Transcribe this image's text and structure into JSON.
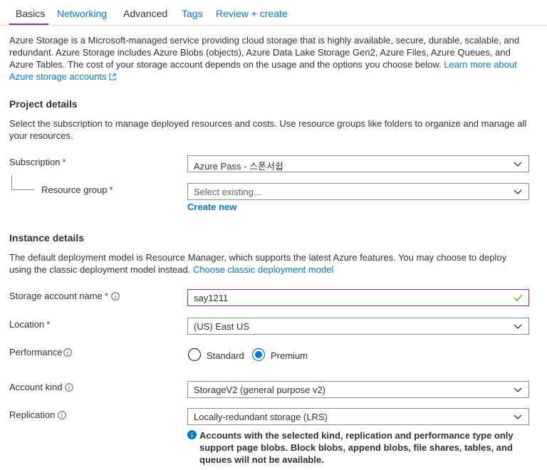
{
  "tabs": [
    {
      "label": "Basics",
      "active": true
    },
    {
      "label": "Networking",
      "active": false
    },
    {
      "label": "Advanced",
      "active": false
    },
    {
      "label": "Tags",
      "active": false
    },
    {
      "label": "Review + create",
      "active": false
    }
  ],
  "intro": {
    "text": "Azure Storage is a Microsoft-managed service providing cloud storage that is highly available, secure, durable, scalable, and redundant. Azure Storage includes Azure Blobs (objects), Azure Data Lake Storage Gen2, Azure Files, Azure Queues, and Azure Tables. The cost of your storage account depends on the usage and the options you choose below.",
    "link": "Learn more about Azure storage accounts"
  },
  "project": {
    "title": "Project details",
    "description": "Select the subscription to manage deployed resources and costs. Use resource groups like folders to organize and manage all your resources.",
    "subscription_label": "Subscription",
    "subscription_value": "Azure Pass - 스폰서쉽",
    "resource_group_label": "Resource group",
    "resource_group_placeholder": "Select existing...",
    "create_new": "Create new"
  },
  "instance": {
    "title": "Instance details",
    "description": "The default deployment model is Resource Manager, which supports the latest Azure features. You may choose to deploy using the classic deployment model instead.",
    "classic_link": "Choose classic deployment model",
    "name_label": "Storage account name",
    "name_value": "say1211",
    "location_label": "Location",
    "location_value": "(US) East US",
    "performance_label": "Performance",
    "performance_options": [
      "Standard",
      "Premium"
    ],
    "performance_selected": "Premium",
    "kind_label": "Account kind",
    "kind_value": "StorageV2 (general purpose v2)",
    "replication_label": "Replication",
    "replication_value": "Locally-redundant storage (LRS)",
    "note": "Accounts with the selected kind, replication and performance type only support page blobs. Block blobs, append blobs, file shares, tables, and queues will not be available."
  },
  "required_marker": "*",
  "colors": {
    "accent": "#0078d4",
    "focus_border": "#8a2da5",
    "required": "#a4262c",
    "valid_check": "#57a300"
  }
}
